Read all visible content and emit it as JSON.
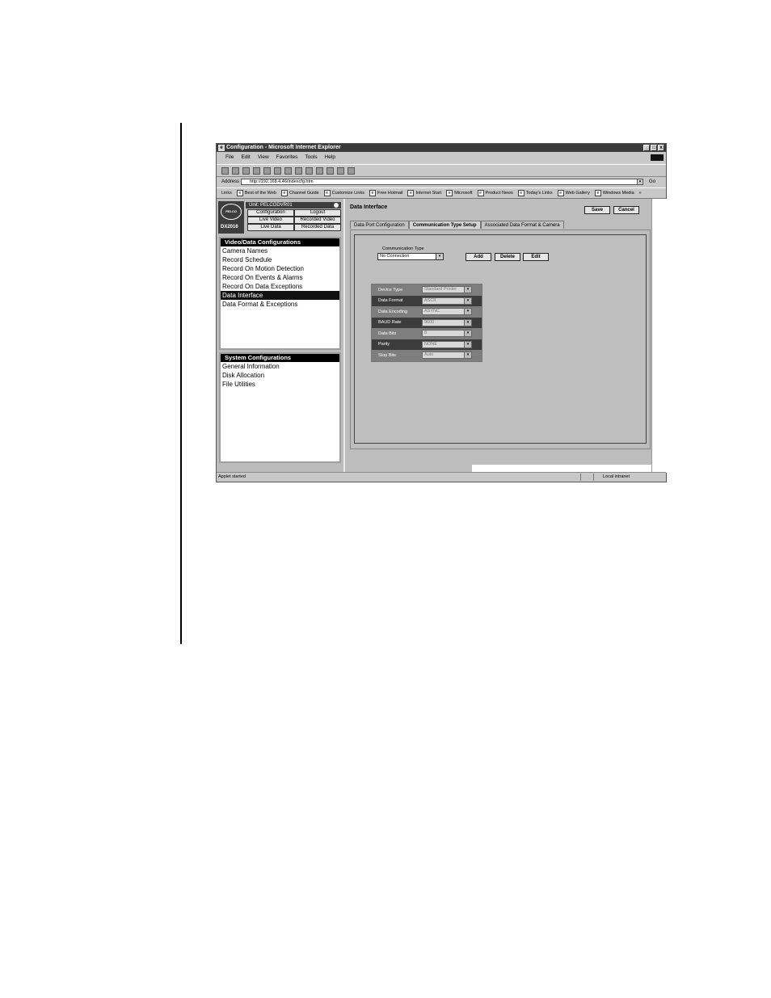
{
  "window": {
    "title": "Configuration - Microsoft Internet Explorer",
    "controls": [
      "_",
      "□",
      "x"
    ]
  },
  "menu": [
    "File",
    "Edit",
    "View",
    "Favorites",
    "Tools",
    "Help"
  ],
  "address": {
    "label": "Address",
    "url": "http://192.168.4.46/indexcfg.htm",
    "go": "Go"
  },
  "links": {
    "label": "Links",
    "items": [
      "Best of the Web",
      "Channel Guide",
      "Customize Links",
      "Free Hotmail",
      "Internet Start",
      "Microsoft",
      "Product News",
      "Today's Links",
      "Web Gallery",
      "Windows Media"
    ],
    "more": "»"
  },
  "sidebar": {
    "logo": "PELCO",
    "model": "DX2016",
    "unit": "Unit: PELCODVR01",
    "nav": [
      "Configuration",
      "Logout",
      "Live Video",
      "Recorded Video",
      "Live Data",
      "Recorded Data"
    ],
    "video_panel": {
      "title": "Video/Data Configurations",
      "items": [
        "Camera Names",
        "Record Schedule",
        "Record On Motion Detection",
        "Record On Events & Alarms",
        "Record On Data Exceptions",
        "Data Interface",
        "Data Format & Exceptions"
      ],
      "selected": "Data Interface"
    },
    "system_panel": {
      "title": "System Configurations",
      "items": [
        "General Information",
        "Disk Allocation",
        "File Utilities"
      ]
    }
  },
  "main": {
    "title": "Data Interface",
    "save": "Save",
    "cancel": "Cancel",
    "tabs": [
      "Data Port Configuration",
      "Communication Type Setup",
      "Associated Data Format & Camera"
    ],
    "active_tab": "Communication Type Setup",
    "comm_type": {
      "label": "Communication Type",
      "value": "No Connection"
    },
    "buttons": {
      "add": "Add",
      "delete": "Delete",
      "edit": "Edit"
    },
    "properties": [
      {
        "label": "Device Type",
        "value": "Standard Printer"
      },
      {
        "label": "Data Format",
        "value": "ASCII"
      },
      {
        "label": "Data Encoding",
        "value": "ASYNC"
      },
      {
        "label": "BAUD Rate",
        "value": "9600"
      },
      {
        "label": "Data Bits",
        "value": "8"
      },
      {
        "label": "Parity",
        "value": "NONE"
      },
      {
        "label": "Stop Bits",
        "value": "Auto"
      }
    ]
  },
  "status": {
    "left": "Applet started",
    "zone": "Local intranet"
  }
}
